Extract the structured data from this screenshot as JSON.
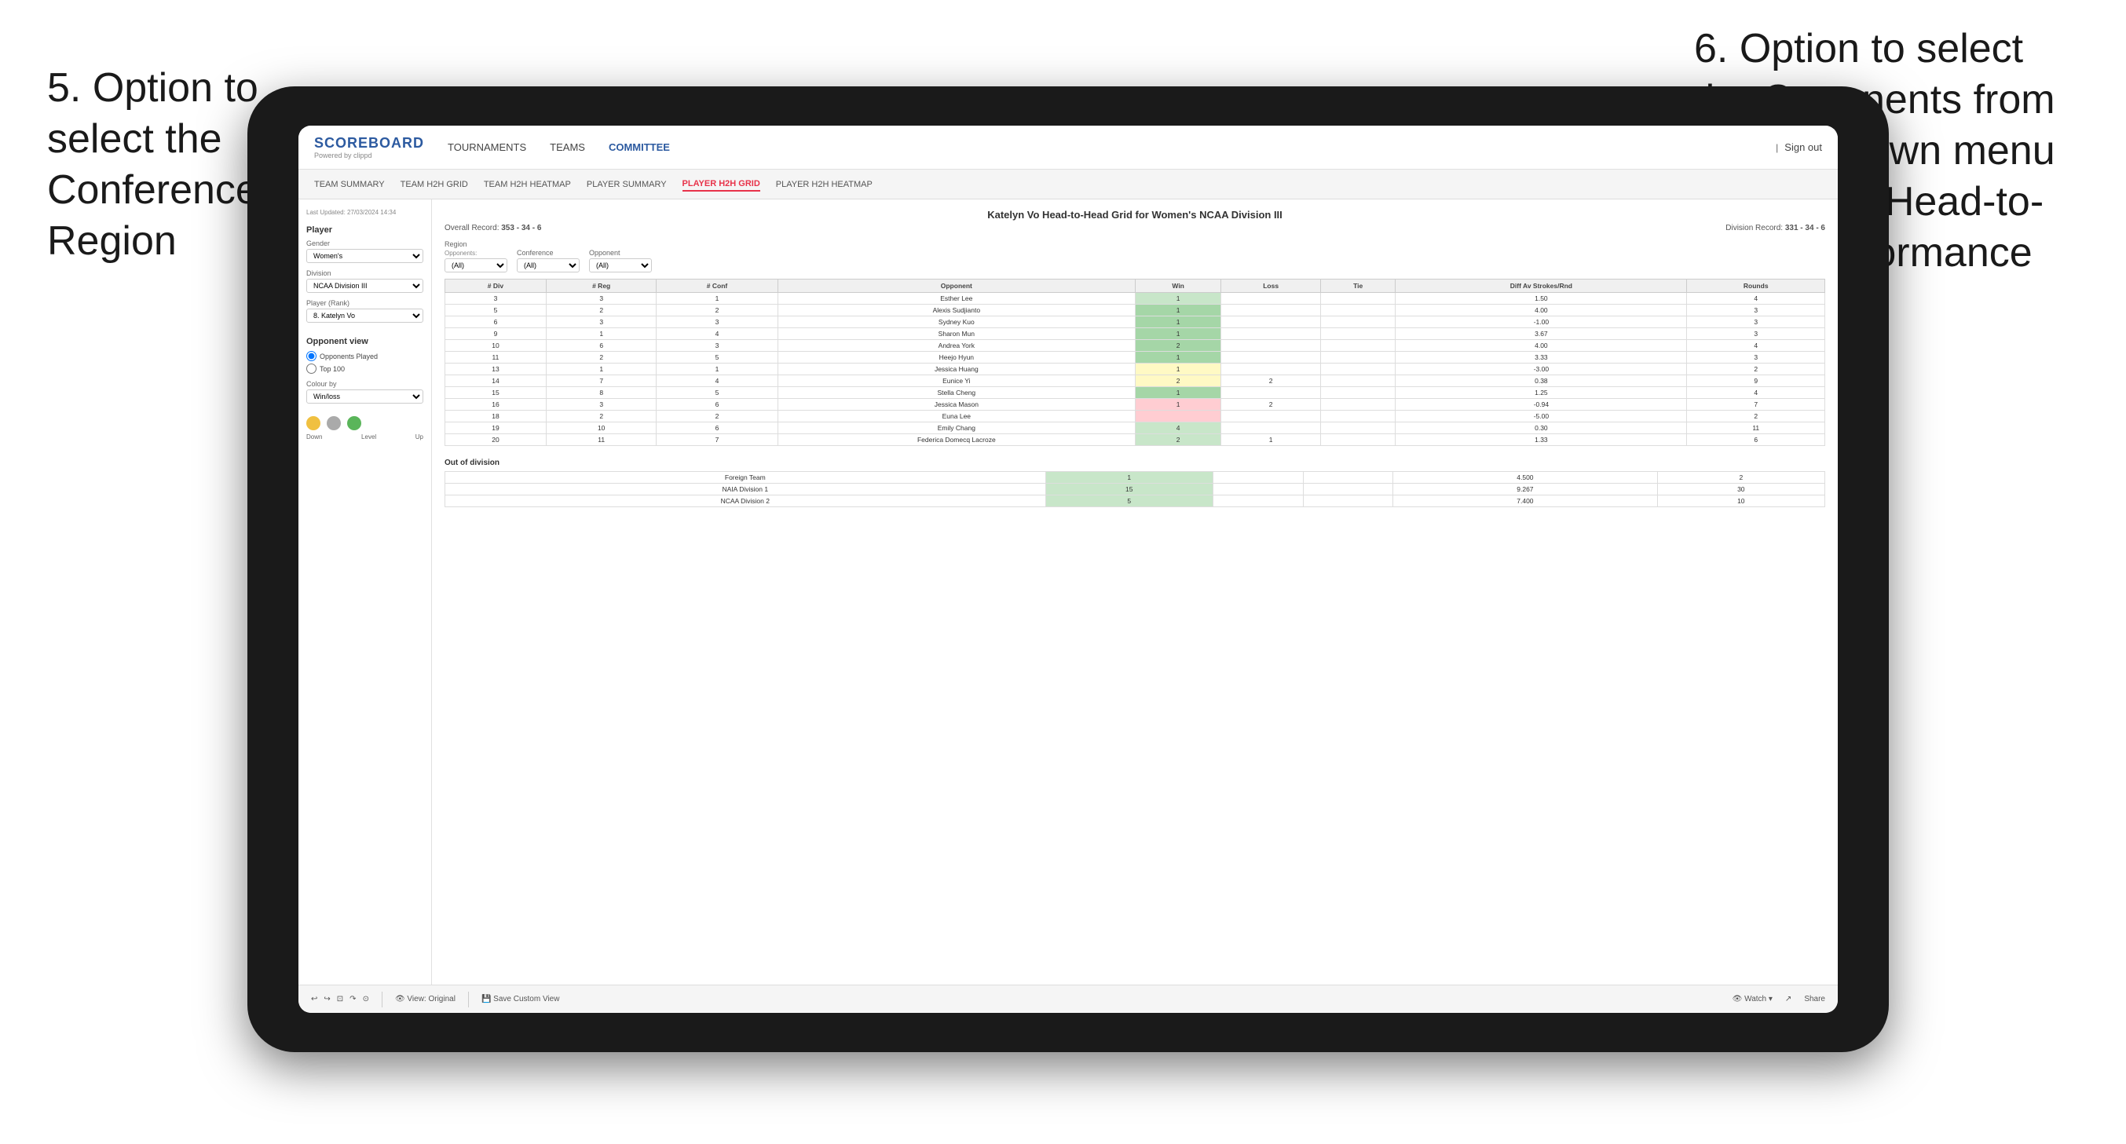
{
  "annotations": {
    "left": "5. Option to select the Conference and Region",
    "right": "6. Option to select the Opponents from the dropdown menu to see the Head-to-Head performance"
  },
  "nav": {
    "logo": "SCOREBOARD",
    "logo_sub": "Powered by clippd",
    "items": [
      "TOURNAMENTS",
      "TEAMS",
      "COMMITTEE"
    ],
    "sign_out": "Sign out",
    "active_nav": "COMMITTEE"
  },
  "sub_nav": {
    "items": [
      "TEAM SUMMARY",
      "TEAM H2H GRID",
      "TEAM H2H HEATMAP",
      "PLAYER SUMMARY",
      "PLAYER H2H GRID",
      "PLAYER H2H HEATMAP"
    ],
    "active": "PLAYER H2H GRID"
  },
  "sidebar": {
    "last_updated": "Last Updated: 27/03/2024 14:34",
    "player_section": "Player",
    "gender_label": "Gender",
    "gender_value": "Women's",
    "division_label": "Division",
    "division_value": "NCAA Division III",
    "player_rank_label": "Player (Rank)",
    "player_rank_value": "8. Katelyn Vo",
    "opponent_view_label": "Opponent view",
    "opponent_view_options": [
      "Opponents Played",
      "Top 100"
    ],
    "colour_by_label": "Colour by",
    "colour_by_value": "Win/loss",
    "colour_labels": [
      "Down",
      "Level",
      "Up"
    ]
  },
  "report": {
    "title": "Katelyn Vo Head-to-Head Grid for Women's NCAA Division III",
    "overall_record_label": "Overall Record:",
    "overall_record": "353 - 34 - 6",
    "division_record_label": "Division Record:",
    "division_record": "331 - 34 - 6"
  },
  "filters": {
    "region_label": "Region",
    "opponents_label": "Opponents:",
    "region_value": "(All)",
    "conference_label": "Conference",
    "conference_value": "(All)",
    "opponent_label": "Opponent",
    "opponent_value": "(All)"
  },
  "table_headers": [
    "# Div",
    "# Reg",
    "# Conf",
    "Opponent",
    "Win",
    "Loss",
    "Tie",
    "Diff Av Strokes/Rnd",
    "Rounds"
  ],
  "table_rows": [
    {
      "div": "3",
      "reg": "3",
      "conf": "1",
      "opponent": "Esther Lee",
      "win": "1",
      "loss": "",
      "tie": "",
      "diff": "1.50",
      "rounds": "4",
      "win_color": "light-green",
      "loss_color": "",
      "tie_color": ""
    },
    {
      "div": "5",
      "reg": "2",
      "conf": "2",
      "opponent": "Alexis Sudjianto",
      "win": "1",
      "loss": "",
      "tie": "",
      "diff": "4.00",
      "rounds": "3",
      "win_color": "green-cell",
      "loss_color": "",
      "tie_color": ""
    },
    {
      "div": "6",
      "reg": "3",
      "conf": "3",
      "opponent": "Sydney Kuo",
      "win": "1",
      "loss": "",
      "tie": "",
      "diff": "-1.00",
      "rounds": "3",
      "win_color": "green-cell",
      "loss_color": "",
      "tie_color": ""
    },
    {
      "div": "9",
      "reg": "1",
      "conf": "4",
      "opponent": "Sharon Mun",
      "win": "1",
      "loss": "",
      "tie": "",
      "diff": "3.67",
      "rounds": "3",
      "win_color": "green-cell",
      "loss_color": "",
      "tie_color": ""
    },
    {
      "div": "10",
      "reg": "6",
      "conf": "3",
      "opponent": "Andrea York",
      "win": "2",
      "loss": "",
      "tie": "",
      "diff": "4.00",
      "rounds": "4",
      "win_color": "green-cell",
      "loss_color": "",
      "tie_color": ""
    },
    {
      "div": "11",
      "reg": "2",
      "conf": "5",
      "opponent": "Heejo Hyun",
      "win": "1",
      "loss": "",
      "tie": "",
      "diff": "3.33",
      "rounds": "3",
      "win_color": "green-cell",
      "loss_color": "",
      "tie_color": ""
    },
    {
      "div": "13",
      "reg": "1",
      "conf": "1",
      "opponent": "Jessica Huang",
      "win": "1",
      "loss": "",
      "tie": "",
      "diff": "-3.00",
      "rounds": "2",
      "win_color": "yellow-cell",
      "loss_color": "",
      "tie_color": ""
    },
    {
      "div": "14",
      "reg": "7",
      "conf": "4",
      "opponent": "Eunice Yi",
      "win": "2",
      "loss": "2",
      "tie": "",
      "diff": "0.38",
      "rounds": "9",
      "win_color": "yellow-cell",
      "loss_color": "",
      "tie_color": ""
    },
    {
      "div": "15",
      "reg": "8",
      "conf": "5",
      "opponent": "Stella Cheng",
      "win": "1",
      "loss": "",
      "tie": "",
      "diff": "1.25",
      "rounds": "4",
      "win_color": "green-cell",
      "loss_color": "",
      "tie_color": ""
    },
    {
      "div": "16",
      "reg": "3",
      "conf": "6",
      "opponent": "Jessica Mason",
      "win": "1",
      "loss": "2",
      "tie": "",
      "diff": "-0.94",
      "rounds": "7",
      "win_color": "red-cell",
      "loss_color": "",
      "tie_color": ""
    },
    {
      "div": "18",
      "reg": "2",
      "conf": "2",
      "opponent": "Euna Lee",
      "win": "",
      "loss": "",
      "tie": "",
      "diff": "-5.00",
      "rounds": "2",
      "win_color": "red-cell",
      "loss_color": "",
      "tie_color": ""
    },
    {
      "div": "19",
      "reg": "10",
      "conf": "6",
      "opponent": "Emily Chang",
      "win": "4",
      "loss": "",
      "tie": "",
      "diff": "0.30",
      "rounds": "11",
      "win_color": "light-green",
      "loss_color": "",
      "tie_color": ""
    },
    {
      "div": "20",
      "reg": "11",
      "conf": "7",
      "opponent": "Federica Domecq Lacroze",
      "win": "2",
      "loss": "1",
      "tie": "",
      "diff": "1.33",
      "rounds": "6",
      "win_color": "light-green",
      "loss_color": "",
      "tie_color": ""
    }
  ],
  "out_of_division": {
    "title": "Out of division",
    "rows": [
      {
        "name": "Foreign Team",
        "win": "1",
        "loss": "",
        "tie": "",
        "diff": "4.500",
        "rounds": "2"
      },
      {
        "name": "NAIA Division 1",
        "win": "15",
        "loss": "",
        "tie": "",
        "diff": "9.267",
        "rounds": "30"
      },
      {
        "name": "NCAA Division 2",
        "win": "5",
        "loss": "",
        "tie": "",
        "diff": "7.400",
        "rounds": "10"
      }
    ]
  },
  "toolbar": {
    "buttons": [
      "↩",
      "↪",
      "⊡",
      "↷",
      "⊙",
      "View: Original",
      "Save Custom View",
      "Watch ▾",
      "↗",
      "↗",
      "Share"
    ]
  }
}
